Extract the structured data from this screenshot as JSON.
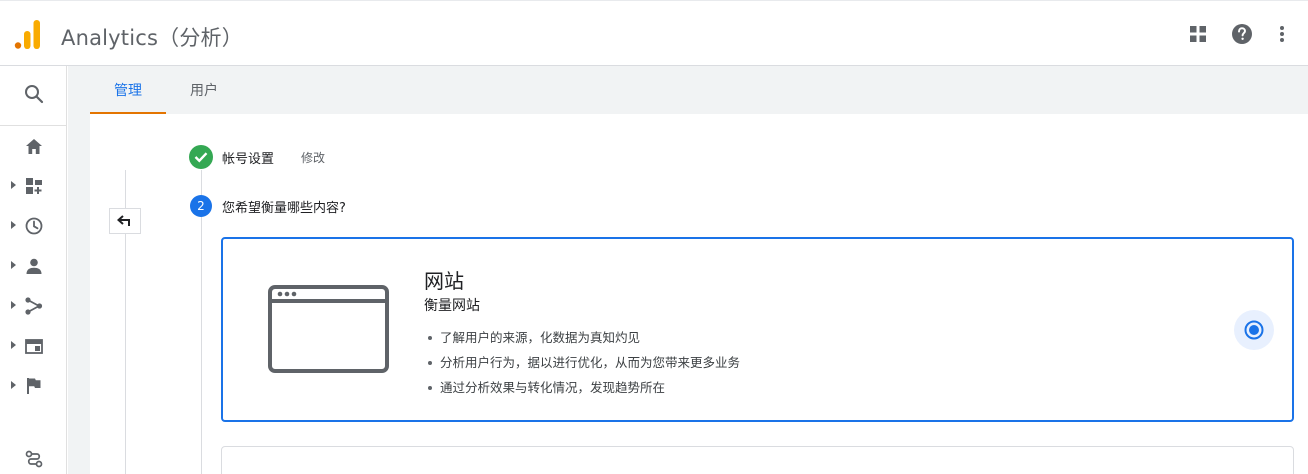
{
  "app": {
    "title": "Analytics（分析）"
  },
  "colors": {
    "accent": "#1a73e8",
    "success": "#34a853",
    "tab_indicator": "#e37400",
    "logo_light": "#f9ab00",
    "logo_dark": "#e37400"
  },
  "header_icons": [
    "apps-icon",
    "help-icon",
    "more-vert-icon"
  ],
  "rail": {
    "items": [
      {
        "icon": "home-icon",
        "expandable": false
      },
      {
        "icon": "customization-icon",
        "expandable": true
      },
      {
        "icon": "realtime-clock-icon",
        "expandable": true
      },
      {
        "icon": "audience-person-icon",
        "expandable": true
      },
      {
        "icon": "acquisition-icon",
        "expandable": true
      },
      {
        "icon": "behavior-icon",
        "expandable": true
      },
      {
        "icon": "conversions-flag-icon",
        "expandable": true
      }
    ],
    "bottom_icon": "attribution-icon"
  },
  "tabs": [
    {
      "label": "管理",
      "active": true
    },
    {
      "label": "用户",
      "active": false
    }
  ],
  "steps": {
    "step1": {
      "title": "帐号设置",
      "edit_label": "修改",
      "status": "done"
    },
    "step2": {
      "number": "2",
      "title": "您希望衡量哪些内容?"
    }
  },
  "card": {
    "title": "网站",
    "subtitle": "衡量网站",
    "bullets": [
      "了解用户的来源，化数据为真知灼见",
      "分析用户行为，据以进行优化，从而为您带来更多业务",
      "通过分析效果与转化情况，发现趋势所在"
    ],
    "selected": true
  }
}
